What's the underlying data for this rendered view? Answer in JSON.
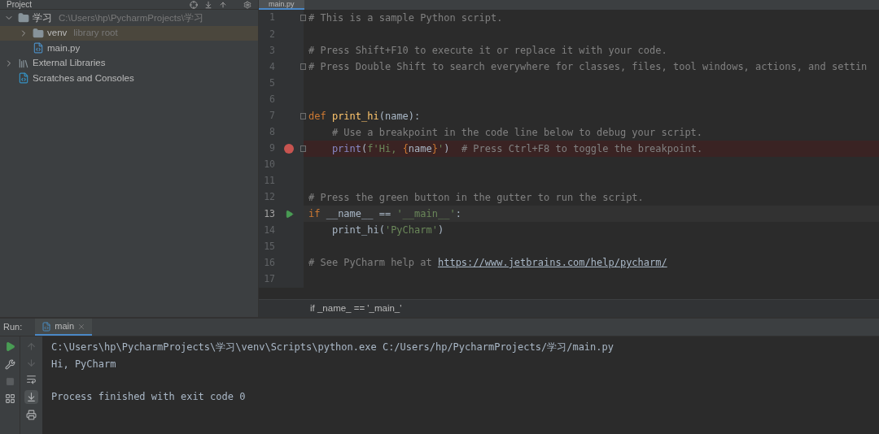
{
  "project_panel": {
    "title": "Project",
    "tree": [
      {
        "label": "学习",
        "hint": "C:\\Users\\hp\\PycharmProjects\\学习",
        "kind": "folder",
        "expanded": true,
        "selected": false,
        "children": [
          {
            "label": "venv",
            "hint": "library root",
            "kind": "folder",
            "expanded": false,
            "selected": true
          },
          {
            "label": "main.py",
            "kind": "python",
            "selected": false
          }
        ]
      },
      {
        "label": "External Libraries",
        "kind": "libraries",
        "expanded": false,
        "selected": false
      },
      {
        "label": "Scratches and Consoles",
        "kind": "scratches",
        "selected": false
      }
    ]
  },
  "editor": {
    "tab": "main.py",
    "lines": [
      {
        "number": "1",
        "fold": true,
        "tokens": [
          {
            "kind": "comment",
            "text": "# This is a sample Python script."
          }
        ]
      },
      {
        "number": "2"
      },
      {
        "number": "3",
        "tokens": [
          {
            "kind": "comment",
            "text": "# Press Shift+F10 to execute it or replace it with your code."
          }
        ]
      },
      {
        "number": "4",
        "fold": true,
        "tokens": [
          {
            "kind": "comment",
            "text": "# Press Double Shift to search everywhere for classes, files, tool windows, actions, and settin"
          }
        ]
      },
      {
        "number": "5"
      },
      {
        "number": "6"
      },
      {
        "number": "7",
        "fold": true,
        "tokens": [
          {
            "kind": "keyword",
            "text": "def "
          },
          {
            "kind": "function",
            "text": "print_hi"
          },
          {
            "kind": "plain",
            "text": "(name):"
          }
        ]
      },
      {
        "number": "8",
        "tokens": [
          {
            "kind": "comment",
            "text": "    # Use a breakpoint in the code line below to debug your script."
          }
        ]
      },
      {
        "number": "9",
        "fold": true,
        "breakpoint": true,
        "tokens": [
          {
            "kind": "builtin",
            "text": "    print"
          },
          {
            "kind": "plain",
            "text": "("
          },
          {
            "kind": "string",
            "text": "f'Hi, "
          },
          {
            "kind": "brace",
            "text": "{"
          },
          {
            "kind": "plain",
            "text": "name"
          },
          {
            "kind": "brace",
            "text": "}"
          },
          {
            "kind": "string",
            "text": "'"
          },
          {
            "kind": "plain",
            "text": ")"
          },
          {
            "kind": "comment",
            "text": "  # Press Ctrl+F8 to toggle the breakpoint."
          }
        ]
      },
      {
        "number": "10"
      },
      {
        "number": "11"
      },
      {
        "number": "12",
        "tokens": [
          {
            "kind": "comment",
            "text": "# Press the green button in the gutter to run the script."
          }
        ]
      },
      {
        "number": "13",
        "run_marker": true,
        "current": true,
        "tokens": [
          {
            "kind": "keyword",
            "text": "if "
          },
          {
            "kind": "plain",
            "text": "__name__ == "
          },
          {
            "kind": "string",
            "text": "'__main__'"
          },
          {
            "kind": "plain",
            "text": ":"
          }
        ]
      },
      {
        "number": "14",
        "tokens": [
          {
            "kind": "plain",
            "text": "    print_hi("
          },
          {
            "kind": "string",
            "text": "'PyCharm'"
          },
          {
            "kind": "plain",
            "text": ")"
          }
        ]
      },
      {
        "number": "15"
      },
      {
        "number": "16",
        "tokens": [
          {
            "kind": "comment",
            "text": "# See PyCharm help at "
          },
          {
            "kind": "link",
            "text": "https://www.jetbrains.com/help/pycharm/"
          }
        ]
      },
      {
        "number": "17"
      }
    ],
    "breadcrumb": "if _name_ == '_main_'"
  },
  "run_panel": {
    "label": "Run:",
    "tab": "main",
    "output": [
      "C:\\Users\\hp\\PycharmProjects\\学习\\venv\\Scripts\\python.exe C:/Users/hp/PycharmProjects/学习/main.py",
      "Hi, PyCharm"
    ],
    "exit_message": "Process finished with exit code 0"
  }
}
